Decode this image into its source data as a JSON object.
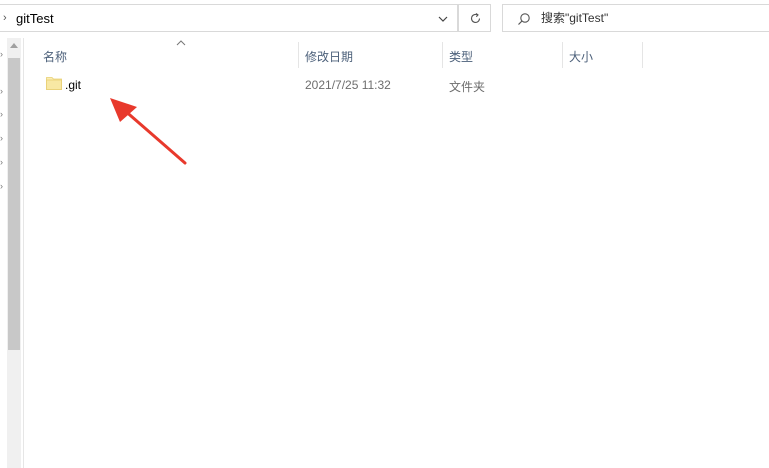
{
  "address_bar": {
    "path": "gitTest",
    "chevron_icon": "chevron-right-icon",
    "dropdown_icon": "chevron-down-icon"
  },
  "refresh": {
    "icon": "refresh-icon"
  },
  "search": {
    "placeholder": "搜索\"gitTest\"",
    "icon": "search-icon"
  },
  "columns": {
    "name": "名称",
    "modified": "修改日期",
    "type": "类型",
    "size": "大小",
    "sort_icon": "sort-ascending-icon"
  },
  "files": [
    {
      "name": ".git",
      "modified": "2021/7/25 11:32",
      "type": "文件夹",
      "size": "",
      "icon": "folder-icon"
    }
  ],
  "annotation": {
    "icon": "red-arrow-icon",
    "color": "#e8392c"
  },
  "colors": {
    "header_text": "#4c607a",
    "folder": "#f8e8a4",
    "arrow": "#e8392c"
  }
}
